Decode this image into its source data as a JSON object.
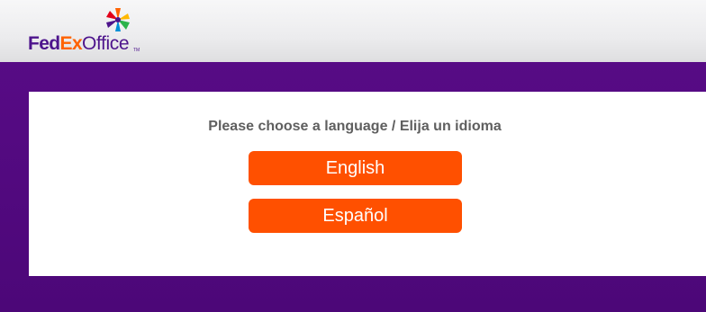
{
  "header": {
    "logo": {
      "fed": "Fed",
      "ex": "Ex",
      "office": "Office",
      "tm": "TM",
      "star_icon": "fedex-office-star-icon"
    }
  },
  "language_select": {
    "prompt": "Please choose a language / Elija un idioma",
    "buttons": [
      {
        "label": "English"
      },
      {
        "label": "Español"
      }
    ]
  },
  "colors": {
    "brand_purple": "#4d148c",
    "brand_orange": "#ff6200",
    "button_orange": "#ff5000",
    "band_purple": "#4c0778",
    "prompt_gray": "#5f5f5f"
  }
}
